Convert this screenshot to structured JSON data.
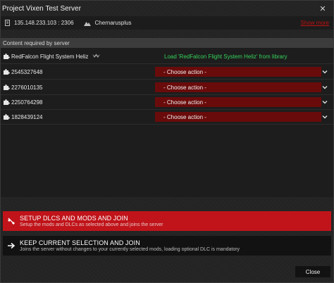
{
  "window": {
    "title": "Project Vixen Test Server",
    "close_icon": "close-icon"
  },
  "server": {
    "ip": "135.148.233.103 : 2306",
    "map": "Chernarusplus",
    "show_more": "Show more"
  },
  "content": {
    "header": "Content required by server",
    "mods": [
      {
        "name": "RedFalcon Flight System Heliz",
        "status": "Load 'RedFalcon Flight System Heliz' from library",
        "kind": "load"
      },
      {
        "name": "2545327648",
        "status": "- Choose action -",
        "kind": "choose"
      },
      {
        "name": "2276010135",
        "status": "- Choose action -",
        "kind": "choose"
      },
      {
        "name": "2250764298",
        "status": "- Choose action -",
        "kind": "choose"
      },
      {
        "name": "1828439124",
        "status": "- Choose action -",
        "kind": "choose"
      }
    ]
  },
  "actions": {
    "setup": {
      "title": "SETUP DLCS AND MODS AND JOIN",
      "subtitle": "Setup the mods and DLCs as selected above and joins the server"
    },
    "keep": {
      "title": "KEEP CURRENT SELECTION AND JOIN",
      "subtitle": "Joins the server without changes to your currently selected mods, loading optional DLC is mandatory"
    },
    "close": "Close"
  },
  "colors": {
    "accent_red": "#c0141a",
    "select_red": "#6a0b0b",
    "load_green": "#35d25a",
    "link_red": "#c01010"
  }
}
